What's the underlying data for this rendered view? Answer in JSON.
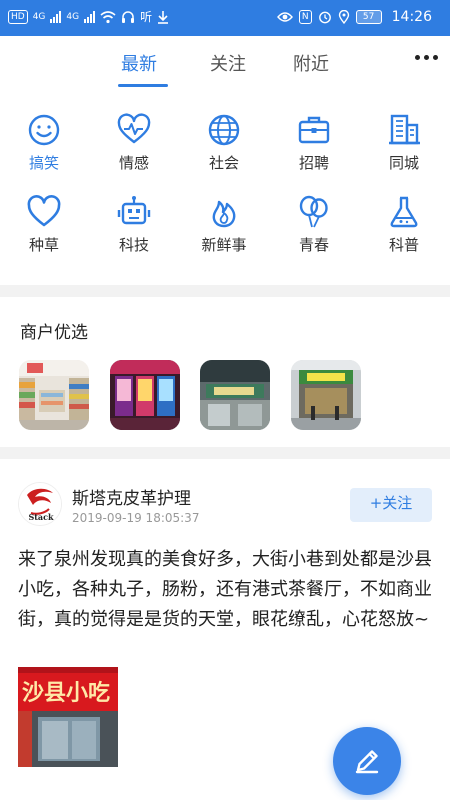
{
  "status_bar": {
    "hd_label": "HD",
    "sim1_label": "4G",
    "sim2_label": "4G",
    "listen_label": "听",
    "nfc_label": "N",
    "battery": "57",
    "time": "14:26"
  },
  "tabs": [
    {
      "label": "最新",
      "active": true
    },
    {
      "label": "关注",
      "active": false
    },
    {
      "label": "附近",
      "active": false
    }
  ],
  "categories": [
    {
      "label": "搞笑",
      "icon": "smile-icon",
      "active": true
    },
    {
      "label": "情感",
      "icon": "heart-pulse-icon",
      "active": false
    },
    {
      "label": "社会",
      "icon": "globe-icon",
      "active": false
    },
    {
      "label": "招聘",
      "icon": "briefcase-icon",
      "active": false
    },
    {
      "label": "同城",
      "icon": "building-icon",
      "active": false
    },
    {
      "label": "种草",
      "icon": "heart-icon",
      "active": false
    },
    {
      "label": "科技",
      "icon": "robot-icon",
      "active": false
    },
    {
      "label": "新鲜事",
      "icon": "flame-icon",
      "active": false
    },
    {
      "label": "青春",
      "icon": "balloons-icon",
      "active": false
    },
    {
      "label": "科普",
      "icon": "flask-icon",
      "active": false
    }
  ],
  "merchants": {
    "title": "商户优选",
    "items": [
      {
        "image": "supermarket-photo"
      },
      {
        "image": "claw-machine-arcade-photo"
      },
      {
        "image": "shopping-mall-photo"
      },
      {
        "image": "storefront-photo"
      }
    ]
  },
  "post": {
    "author": "斯塔克皮革护理",
    "avatar_text": "Stack",
    "time": "2019-09-19 18:05:37",
    "follow_label": "+关注",
    "text": "来了泉州发现真的美食好多，大街小巷到处都是沙县小吃，各种丸子，肠粉，还有港式茶餐厅，不如商业街，真的觉得是是货的天堂，眼花缭乱，心花怒放~",
    "image_sign": "沙县小吃"
  },
  "colors": {
    "accent": "#2f7de1",
    "status_bar": "#2f7de1",
    "divider": "#f2f2f2",
    "follow_bg": "#e3eefb"
  },
  "fab": {
    "icon": "pencil-icon"
  }
}
